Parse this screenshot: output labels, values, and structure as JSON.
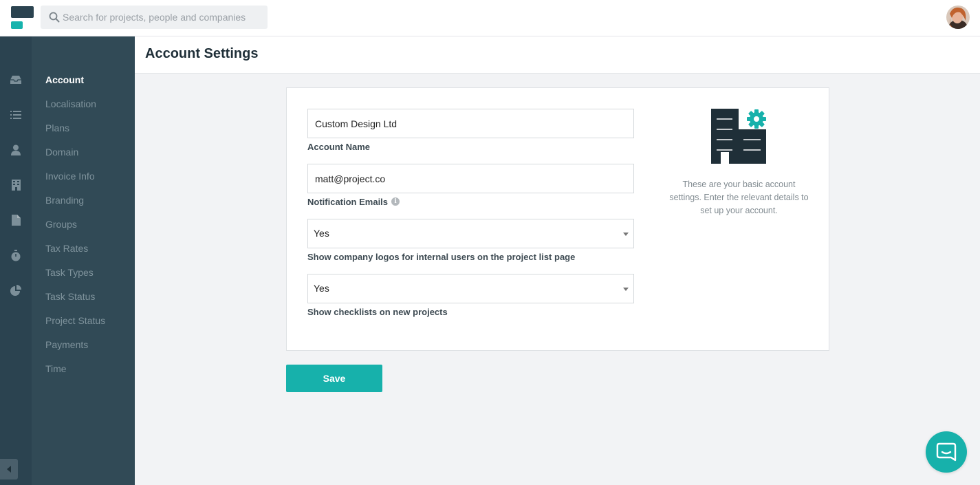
{
  "search": {
    "placeholder": "Search for projects, people and companies"
  },
  "nav_rail": {
    "icons": [
      "inbox-icon",
      "list-icon",
      "person-icon",
      "building-icon",
      "document-icon",
      "stopwatch-icon",
      "pie-chart-icon"
    ],
    "collapse_icon": "chevron-left-icon"
  },
  "settings_nav": {
    "items": [
      {
        "label": "Account",
        "active": true
      },
      {
        "label": "Localisation"
      },
      {
        "label": "Plans"
      },
      {
        "label": "Domain"
      },
      {
        "label": "Invoice Info"
      },
      {
        "label": "Branding"
      },
      {
        "label": "Groups"
      },
      {
        "label": "Tax Rates"
      },
      {
        "label": "Task Types"
      },
      {
        "label": "Task Status"
      },
      {
        "label": "Project Status"
      },
      {
        "label": "Payments"
      },
      {
        "label": "Time"
      }
    ]
  },
  "page": {
    "title": "Account Settings"
  },
  "form": {
    "account_name": {
      "value": "Custom Design Ltd",
      "label": "Account Name"
    },
    "notification_emails": {
      "value": "matt@project.co",
      "label": "Notification Emails",
      "info_icon": "i"
    },
    "show_logos": {
      "value": "Yes",
      "label": "Show company logos for internal users on the project list page"
    },
    "show_checklists": {
      "value": "Yes",
      "label": "Show checklists on new projects"
    }
  },
  "side_panel": {
    "icon": "building-settings-icon",
    "description": "These are your basic account settings. Enter the relevant details to set up your account."
  },
  "actions": {
    "save_label": "Save"
  },
  "colors": {
    "accent": "#17b1ab",
    "rail": "#2b4350",
    "subnav": "#314a56",
    "icon_dark": "#1f2f38"
  }
}
